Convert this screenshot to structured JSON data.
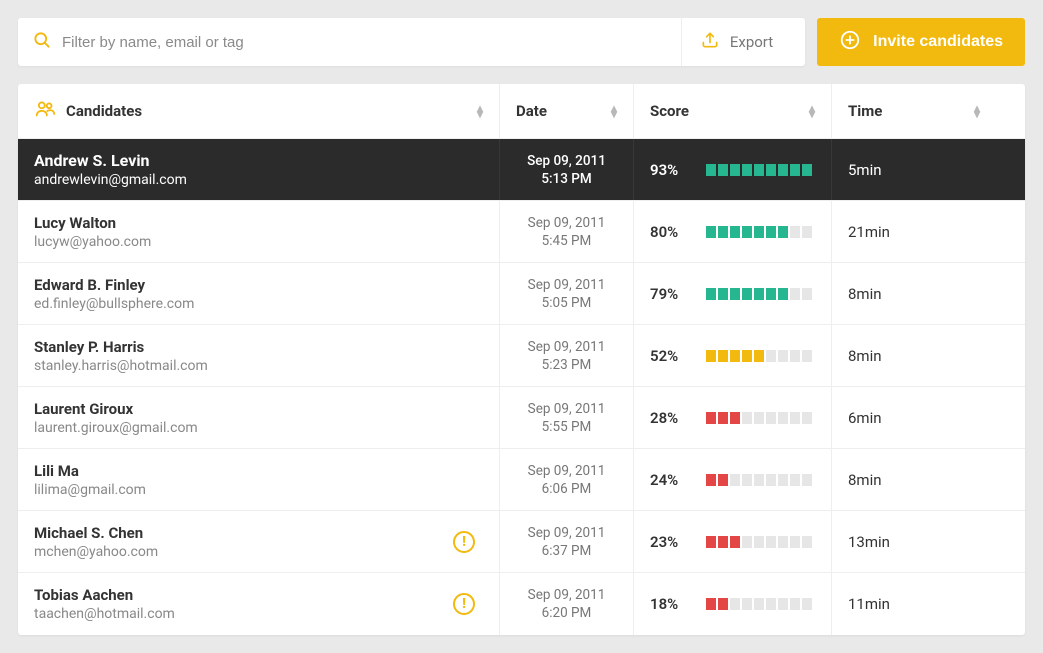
{
  "filter": {
    "placeholder": "Filter by name, email or tag"
  },
  "export": {
    "label": "Export"
  },
  "invite": {
    "label": "Invite candidates"
  },
  "headers": {
    "candidates": "Candidates",
    "date": "Date",
    "score": "Score",
    "time": "Time"
  },
  "score_bar": {
    "segments": 9
  },
  "rows": [
    {
      "name": "Andrew S. Levin",
      "email": "andrewlevin@gmail.com",
      "date": "Sep 09, 2011",
      "time_str": "5:13 PM",
      "score_pct": "93%",
      "score_filled": 9,
      "score_color": "green",
      "time_taken": "5min",
      "selected": true,
      "warn": false
    },
    {
      "name": "Lucy Walton",
      "email": "lucyw@yahoo.com",
      "date": "Sep 09, 2011",
      "time_str": "5:45 PM",
      "score_pct": "80%",
      "score_filled": 7,
      "score_color": "green",
      "time_taken": "21min",
      "selected": false,
      "warn": false
    },
    {
      "name": "Edward B. Finley",
      "email": "ed.finley@bullsphere.com",
      "date": "Sep 09, 2011",
      "time_str": "5:05 PM",
      "score_pct": "79%",
      "score_filled": 7,
      "score_color": "green",
      "time_taken": "8min",
      "selected": false,
      "warn": false
    },
    {
      "name": "Stanley P. Harris",
      "email": "stanley.harris@hotmail.com",
      "date": "Sep 09, 2011",
      "time_str": "5:23 PM",
      "score_pct": "52%",
      "score_filled": 5,
      "score_color": "yellow",
      "time_taken": "8min",
      "selected": false,
      "warn": false
    },
    {
      "name": "Laurent Giroux",
      "email": "laurent.giroux@gmail.com",
      "date": "Sep 09, 2011",
      "time_str": "5:55 PM",
      "score_pct": "28%",
      "score_filled": 3,
      "score_color": "red",
      "time_taken": "6min",
      "selected": false,
      "warn": false
    },
    {
      "name": "Lili Ma",
      "email": "lilima@gmail.com",
      "date": "Sep 09, 2011",
      "time_str": "6:06 PM",
      "score_pct": "24%",
      "score_filled": 2,
      "score_color": "red",
      "time_taken": "8min",
      "selected": false,
      "warn": false
    },
    {
      "name": "Michael S. Chen",
      "email": "mchen@yahoo.com",
      "date": "Sep 09, 2011",
      "time_str": "6:37 PM",
      "score_pct": "23%",
      "score_filled": 3,
      "score_color": "red",
      "time_taken": "13min",
      "selected": false,
      "warn": true
    },
    {
      "name": "Tobias Aachen",
      "email": "taachen@hotmail.com",
      "date": "Sep 09, 2011",
      "time_str": "6:20 PM",
      "score_pct": "18%",
      "score_filled": 2,
      "score_color": "red",
      "time_taken": "11min",
      "selected": false,
      "warn": true
    }
  ]
}
